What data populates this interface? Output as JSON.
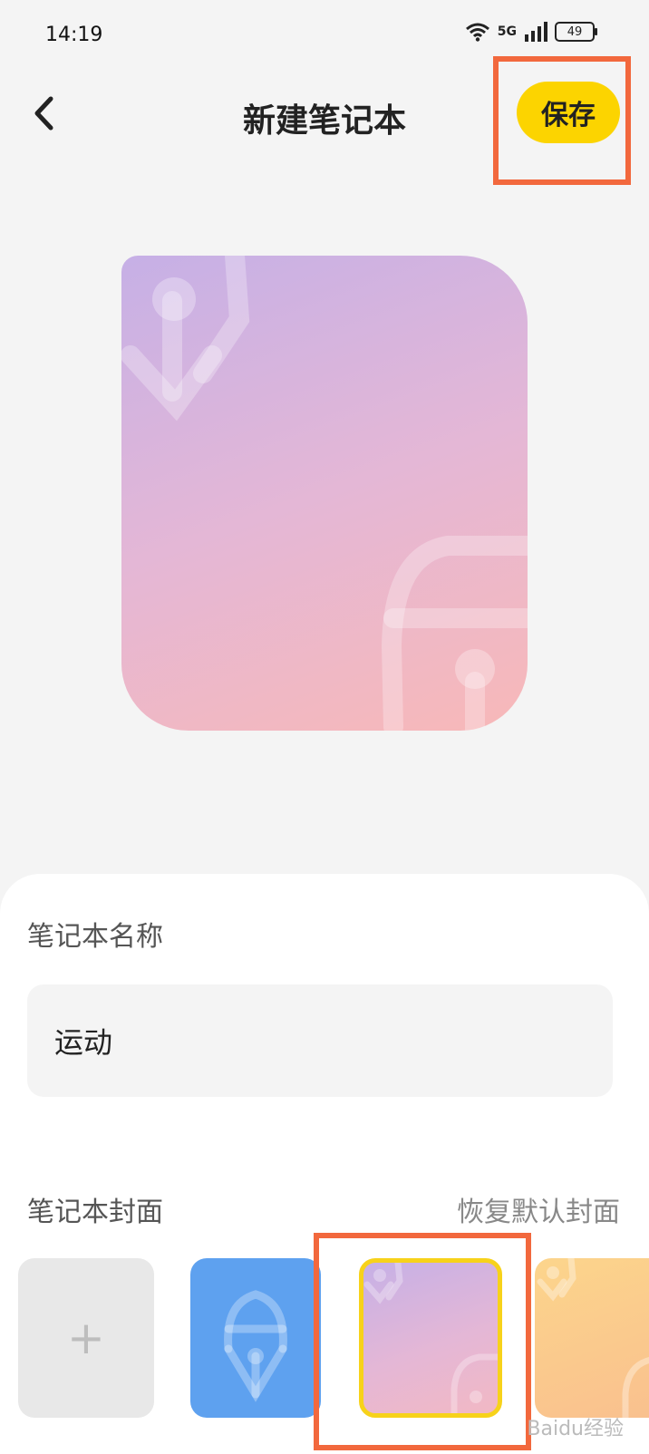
{
  "status_bar": {
    "time": "14:19",
    "network": "5G",
    "battery": "49",
    "icons": [
      "wifi-icon",
      "signal-icon",
      "battery-icon"
    ]
  },
  "header": {
    "back_icon": "chevron-left-icon",
    "title": "新建笔记本",
    "save_label": "保存"
  },
  "form": {
    "name_label": "笔记本名称",
    "name_value": "运动",
    "cover_label": "笔记本封面",
    "restore_label": "恢复默认封面"
  },
  "cover_options": [
    {
      "id": "add",
      "label": "+"
    },
    {
      "id": "blue-pen",
      "color": "#5ea1ef"
    },
    {
      "id": "purple-pink-pen",
      "selected": true
    },
    {
      "id": "orange-pen",
      "color": "#fcd58c"
    }
  ],
  "colors": {
    "accent": "#fcd400",
    "highlight": "#f2683d",
    "selected_border": "#f7d21a"
  },
  "watermark": "Baidu经验"
}
